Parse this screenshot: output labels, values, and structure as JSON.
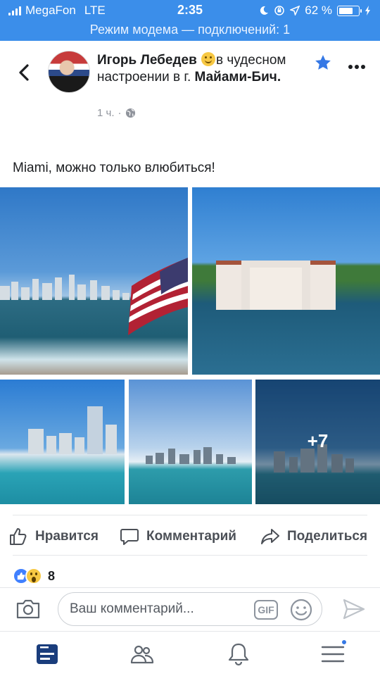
{
  "status_bar": {
    "carrier": "MegaFon",
    "network": "LTE",
    "time": "2:35",
    "battery": "62 %",
    "battery_level": 0.62
  },
  "hotspot_banner": "Режим модема — подключений: 1",
  "post": {
    "author": "Игорь Лебедев",
    "feeling_prefix": "в",
    "feeling_text": "чудесном настроении в г.",
    "place": "Майами-Бич.",
    "time": "1 ч.",
    "separator": "·",
    "text": "Miami, можно только влюбиться!",
    "more_photos": "+7"
  },
  "actions": {
    "like": "Нравится",
    "comment": "Комментарий",
    "share": "Поделиться"
  },
  "reactions": {
    "count": "8",
    "types": [
      "like",
      "wow"
    ]
  },
  "composer": {
    "placeholder": "Ваш комментарий...",
    "gif_label": "GIF"
  },
  "colors": {
    "brand_blue": "#3b8eea",
    "fb_blue": "#4080ff",
    "text_primary": "#1c1e21",
    "text_secondary": "#90949c"
  },
  "icons": [
    "back-icon",
    "star-icon",
    "more-icon",
    "globe-icon",
    "like-icon",
    "comment-icon",
    "share-icon",
    "camera-icon",
    "gif-icon",
    "emoji-icon",
    "send-icon",
    "news-feed-icon",
    "friends-icon",
    "notifications-icon",
    "menu-icon"
  ]
}
